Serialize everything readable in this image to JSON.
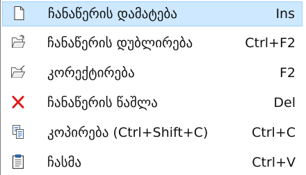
{
  "menu": {
    "items": [
      {
        "label": "ჩანაწერის დამატება",
        "shortcut": "Ins",
        "icon": "new-document-icon"
      },
      {
        "label": "ჩანაწერის დუბლირება",
        "shortcut": "Ctrl+F2",
        "icon": "duplicate-folder-icon"
      },
      {
        "label": "კორექტირება",
        "shortcut": "F2",
        "icon": "open-folder-edit-icon"
      },
      {
        "label": "ჩანაწერის წაშლა",
        "shortcut": "Del",
        "icon": "delete-x-icon"
      },
      {
        "label": "კოპირება (Ctrl+Shift+C)",
        "shortcut": "Ctrl+C",
        "icon": "copy-documents-icon"
      },
      {
        "label": "ჩასმა",
        "shortcut": "Ctrl+V",
        "icon": "paste-clipboard-icon"
      }
    ]
  },
  "colors": {
    "highlight_background": "#cde8ff",
    "highlight_border": "#99d1ff",
    "delete_icon": "#e01818"
  }
}
